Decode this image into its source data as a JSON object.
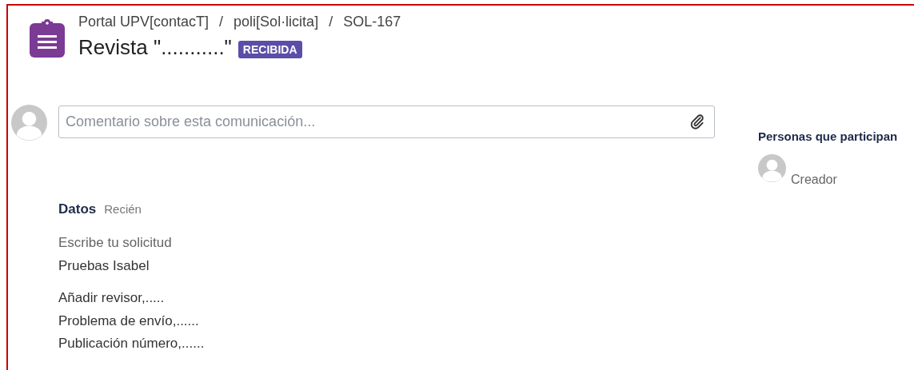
{
  "breadcrumb": [
    "Portal UPV[contacT]",
    "poli[Sol·licita]",
    "SOL-167"
  ],
  "breadcrumb_separator": "/",
  "title": "Revista \"...........\"",
  "status": "RECIBIDA",
  "comment": {
    "placeholder": "Comentario sobre esta comunicación..."
  },
  "message": {
    "author": "Datos",
    "time": "Recién",
    "groups": [
      [
        "Escribe tu solicitud",
        "Pruebas Isabel"
      ],
      [
        "Añadir revisor,.....",
        "Problema de envío,......",
        "Publicación número,......"
      ]
    ]
  },
  "participants": {
    "heading": "Personas que participan",
    "people": [
      {
        "role": "Creador"
      }
    ]
  }
}
